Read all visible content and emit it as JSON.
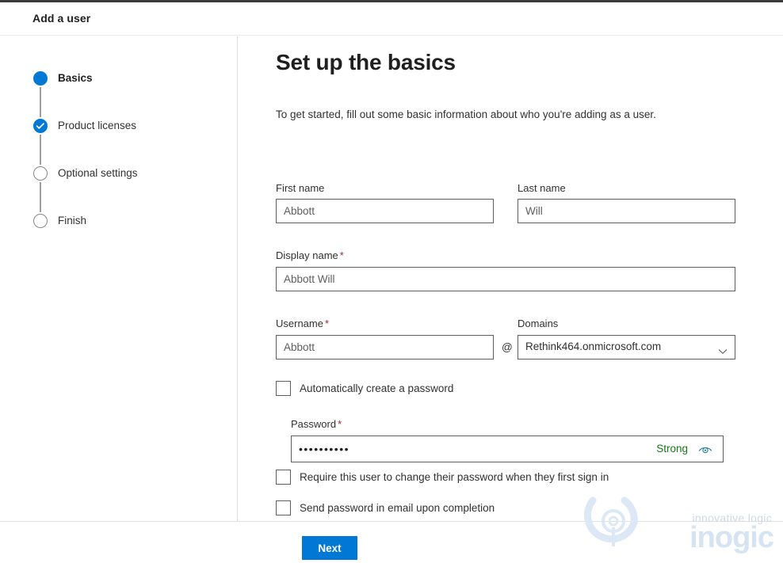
{
  "window": {
    "title": "Add a user"
  },
  "wizard": {
    "steps": [
      {
        "label": "Basics",
        "state": "current",
        "marker": "filled-dot-icon"
      },
      {
        "label": "Product licenses",
        "state": "completed",
        "marker": "check-circle-icon"
      },
      {
        "label": "Optional settings",
        "state": "pending",
        "marker": "empty-circle-icon"
      },
      {
        "label": "Finish",
        "state": "pending",
        "marker": "empty-circle-icon"
      }
    ]
  },
  "main": {
    "heading": "Set up the basics",
    "description": "To get started, fill out some basic information about who you're adding as a user.",
    "fields": {
      "first_name": {
        "label": "First name",
        "value": "Abbott",
        "placeholder": "First name",
        "required": false
      },
      "last_name": {
        "label": "Last name",
        "value": "Will",
        "placeholder": "Last name",
        "required": false
      },
      "display_name": {
        "label": "Display name",
        "value": "Abbott Will",
        "placeholder": "Display name",
        "required": true,
        "required_marker": "*"
      },
      "username": {
        "label": "Username",
        "value": "Abbott",
        "placeholder": "Username",
        "required": true,
        "required_marker": "*"
      },
      "at_separator": "@",
      "domains": {
        "label": "Domains",
        "selected": "Rethink464.onmicrosoft.com",
        "chevron": "chevron-down-icon"
      },
      "password": {
        "label": "Password",
        "required": true,
        "required_marker": "*",
        "masked_value": "••••••••••",
        "strength": "Strong",
        "reveal_icon": "eye-icon"
      }
    },
    "checkboxes": [
      {
        "label": "Automatically create a password",
        "checked": false
      },
      {
        "label": "Require this user to change their password when they first sign in",
        "checked": false
      },
      {
        "label": "Send password in email upon completion",
        "checked": false
      }
    ]
  },
  "footer": {
    "next_label": "Next"
  },
  "watermark": {
    "tagline": "innovative logic",
    "brand": "inogic",
    "logo": "inogic-logo-icon"
  },
  "colors": {
    "accent": "#0078d4",
    "strength_ok": "#107c10",
    "required": "#a4262c",
    "text": "#201f1e",
    "border": "#605e5c",
    "divider": "#e1dfdd",
    "watermark": "#d5e3f2"
  }
}
